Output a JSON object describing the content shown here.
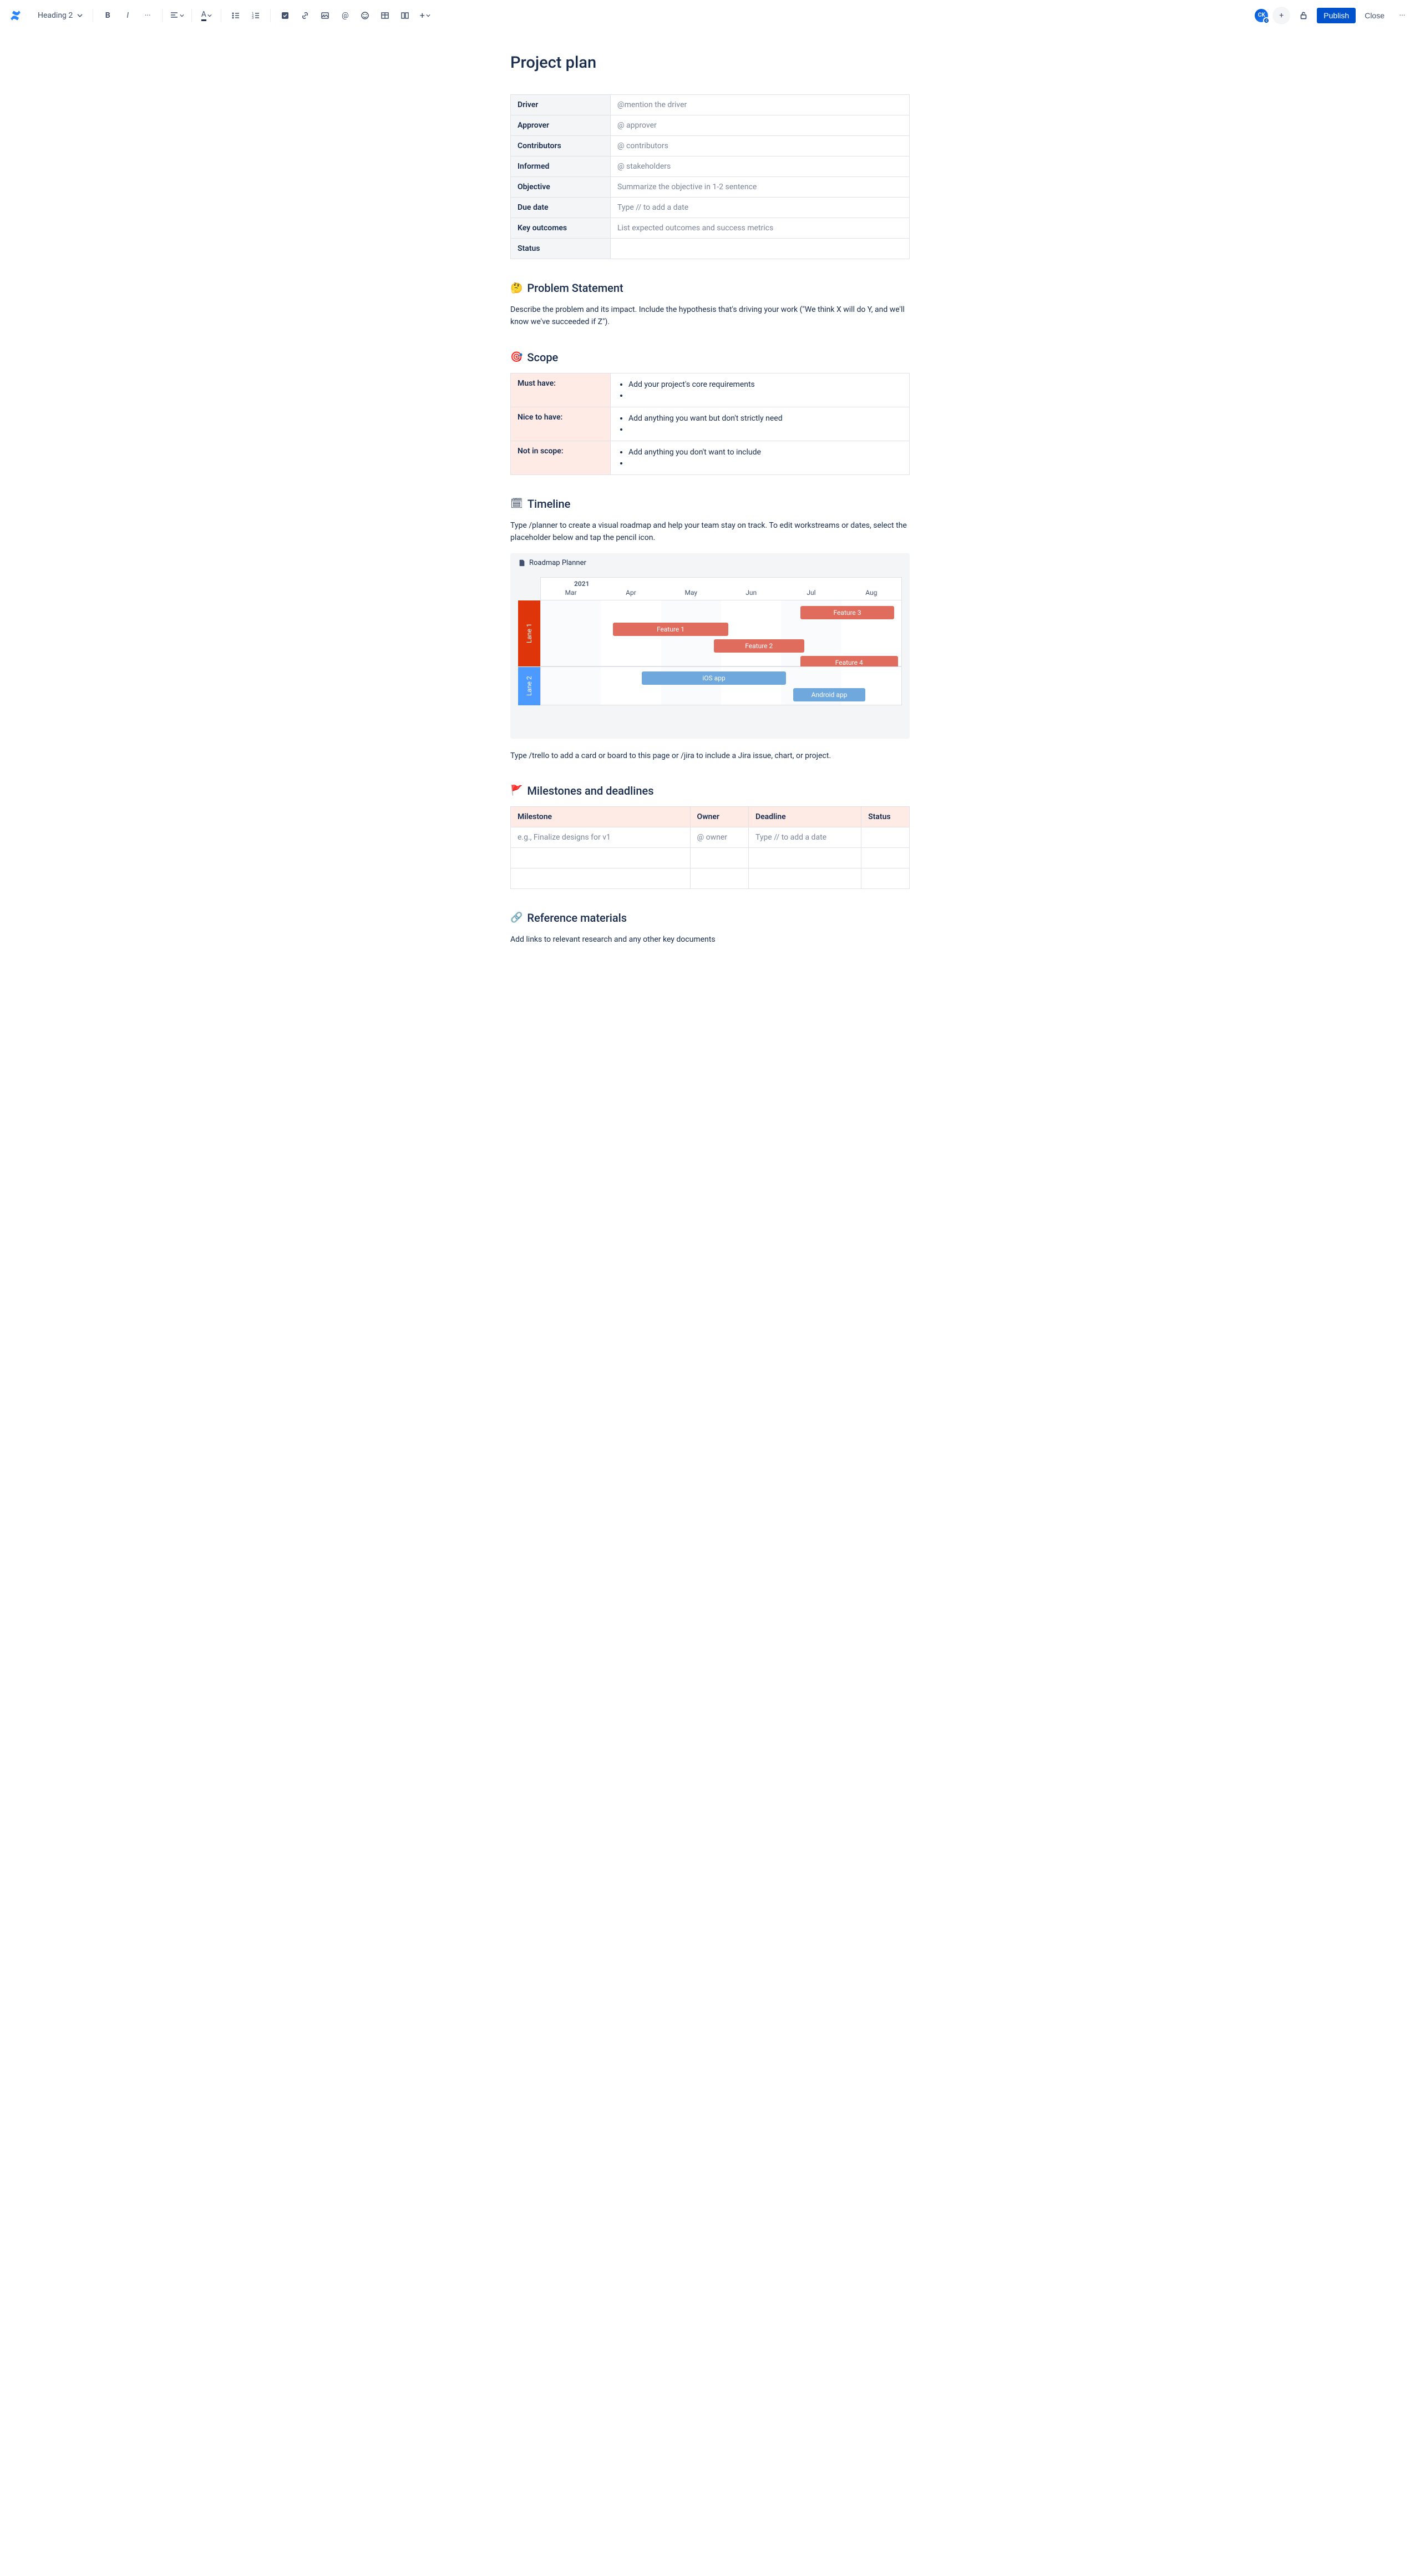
{
  "toolbar": {
    "text_style": "Heading 2",
    "publish": "Publish",
    "close": "Close",
    "avatar_initials": "CK"
  },
  "page": {
    "title": "Project plan"
  },
  "meta_table": {
    "rows": [
      {
        "label": "Driver",
        "value": "@mention the driver"
      },
      {
        "label": "Approver",
        "value": "@ approver"
      },
      {
        "label": "Contributors",
        "value": "@ contributors"
      },
      {
        "label": "Informed",
        "value": "@ stakeholders"
      },
      {
        "label": "Objective",
        "value": "Summarize the objective in 1-2 sentence"
      },
      {
        "label": "Due date",
        "value": "Type // to add a date"
      },
      {
        "label": "Key outcomes",
        "value": "List expected outcomes and success metrics"
      },
      {
        "label": "Status",
        "value": ""
      }
    ]
  },
  "sections": {
    "problem": {
      "emoji": "🤔",
      "title": "Problem Statement",
      "body": "Describe the problem and its impact. Include the hypothesis that's driving your work (\"We think X will do Y, and we'll know we've succeeded if Z\")."
    },
    "scope": {
      "emoji": "🎯",
      "title": "Scope",
      "rows": [
        {
          "label": "Must have:",
          "item": "Add your project's core requirements"
        },
        {
          "label": "Nice to have:",
          "item": "Add anything you want but don't strictly need"
        },
        {
          "label": "Not in scope:",
          "item": "Add anything you don't want to include"
        }
      ]
    },
    "timeline": {
      "emoji": "🗓",
      "title": "Timeline",
      "intro": "Type /planner to create a visual roadmap and help your team stay on track. To edit workstreams or dates, select the placeholder below and tap the pencil icon.",
      "outro": "Type /trello to add a card or board to this page or /jira to include a Jira issue, chart, or project."
    },
    "milestones": {
      "emoji": "🚩",
      "title": "Milestones and deadlines",
      "headers": {
        "c1": "Milestone",
        "c2": "Owner",
        "c3": "Deadline",
        "c4": "Status"
      },
      "row1": {
        "c1": "e.g., Finalize designs for v1",
        "c2": "@ owner",
        "c3": "Type // to add a date",
        "c4": ""
      }
    },
    "reference": {
      "emoji": "🔗",
      "title": "Reference materials",
      "body": "Add links to relevant research and any other key documents"
    }
  },
  "roadmap": {
    "title": "Roadmap Planner",
    "year": "2021",
    "months": [
      "Mar",
      "Apr",
      "May",
      "Jun",
      "Jul",
      "Aug"
    ],
    "lane1": "Lane 1",
    "lane2": "Lane 2",
    "bars": {
      "f1": "Feature 1",
      "f2": "Feature 2",
      "f3": "Feature 3",
      "f4": "Feature 4",
      "ios": "iOS app",
      "android": "Android app"
    }
  }
}
